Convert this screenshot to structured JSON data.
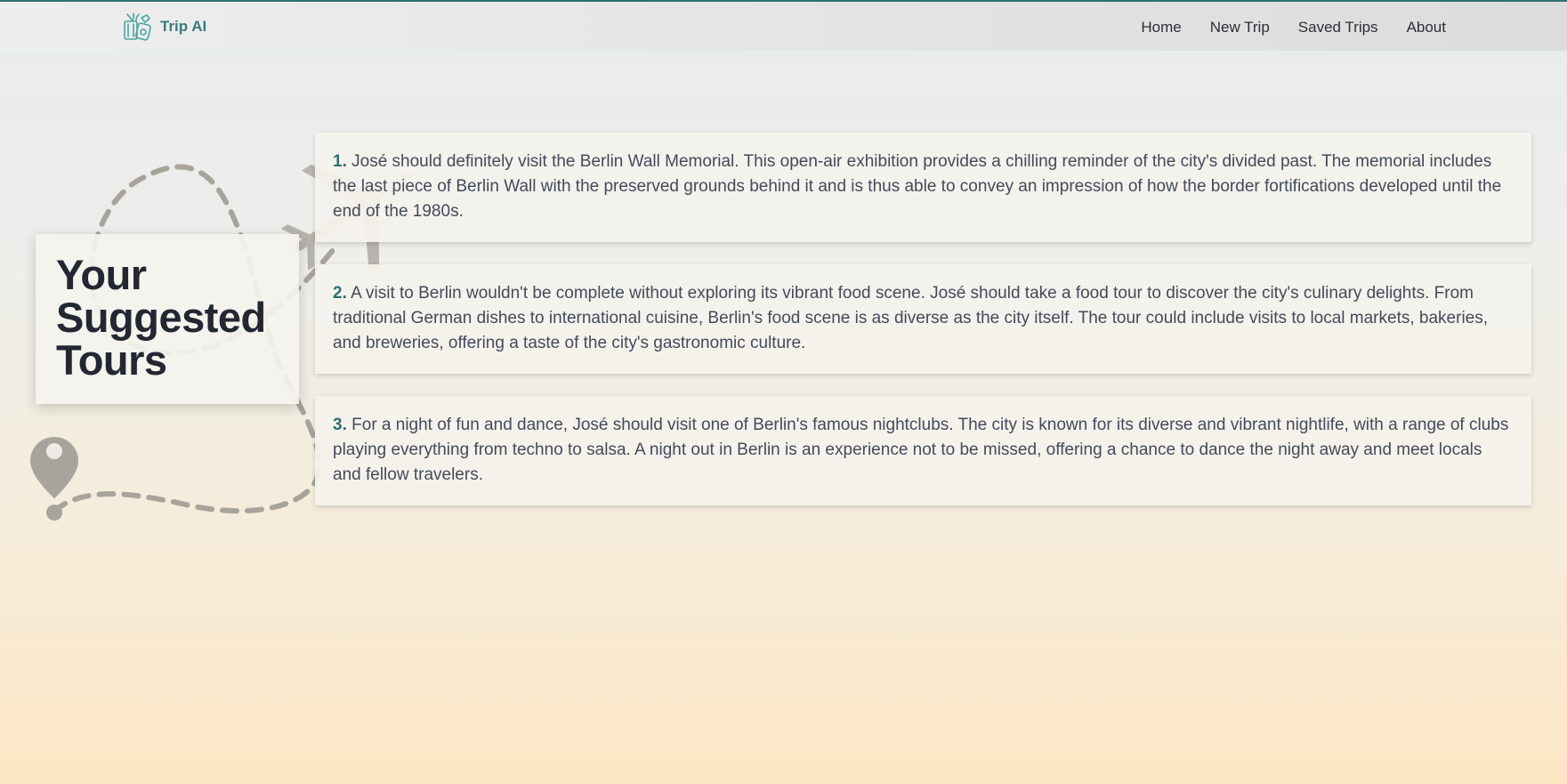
{
  "app": {
    "brand_name": "Trip AI",
    "brand_icon": "luggage-icon",
    "accent_color": "#2f6f72"
  },
  "nav": {
    "items": [
      {
        "label": "Home"
      },
      {
        "label": "New Trip"
      },
      {
        "label": "Saved Trips"
      },
      {
        "label": "About"
      }
    ]
  },
  "page": {
    "title_line1": "Your",
    "title_line2": "Suggested",
    "title_line3": "Tours"
  },
  "decor": {
    "icons": [
      "airplane-icon",
      "map-pin-icon",
      "dashed-route"
    ]
  },
  "tours": [
    {
      "number": "1.",
      "text": "José should definitely visit the Berlin Wall Memorial. This open-air exhibition provides a chilling reminder of the city's divided past. The memorial includes the last piece of Berlin Wall with the preserved grounds behind it and is thus able to convey an impression of how the border fortifications developed until the end of the 1980s."
    },
    {
      "number": "2.",
      "text": "A visit to Berlin wouldn't be complete without exploring its vibrant food scene. José should take a food tour to discover the city's culinary delights. From traditional German dishes to international cuisine, Berlin's food scene is as diverse as the city itself. The tour could include visits to local markets, bakeries, and breweries, offering a taste of the city's gastronomic culture."
    },
    {
      "number": "3.",
      "text": "For a night of fun and dance, José should visit one of Berlin's famous nightclubs. The city is known for its diverse and vibrant nightlife, with a range of clubs playing everything from techno to salsa. A night out in Berlin is an experience not to be missed, offering a chance to dance the night away and meet locals and fellow travelers."
    }
  ]
}
